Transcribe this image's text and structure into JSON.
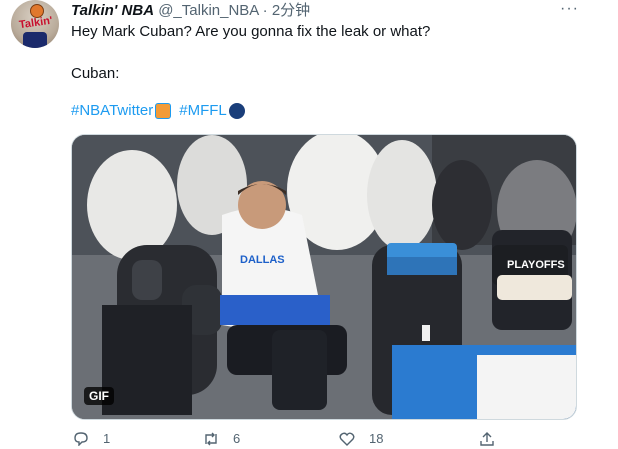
{
  "tweet": {
    "display_name": "Talkin' NBA",
    "handle": "@_Talkin_NBA",
    "separator": "·",
    "time": "2分钟",
    "more_icon": "more-horizontal-icon",
    "line1": "Hey Mark Cuban? Are you gonna fix the leak or what?",
    "line2": "Cuban:",
    "hashtags": [
      "#NBATwitter",
      "#MFFL"
    ],
    "avatar_text": "Talkin'"
  },
  "media": {
    "type_badge": "GIF",
    "shirt_text": "DALLAS",
    "playoffs_text": "PLAYOFFS"
  },
  "actions": {
    "reply_count": "1",
    "retweet_count": "6",
    "like_count": "18",
    "icons": [
      "reply-icon",
      "retweet-icon",
      "like-icon",
      "share-icon"
    ]
  },
  "colors": {
    "link": "#1d9bf0",
    "secondary_text": "#536471",
    "primary_text": "#0f1419"
  }
}
